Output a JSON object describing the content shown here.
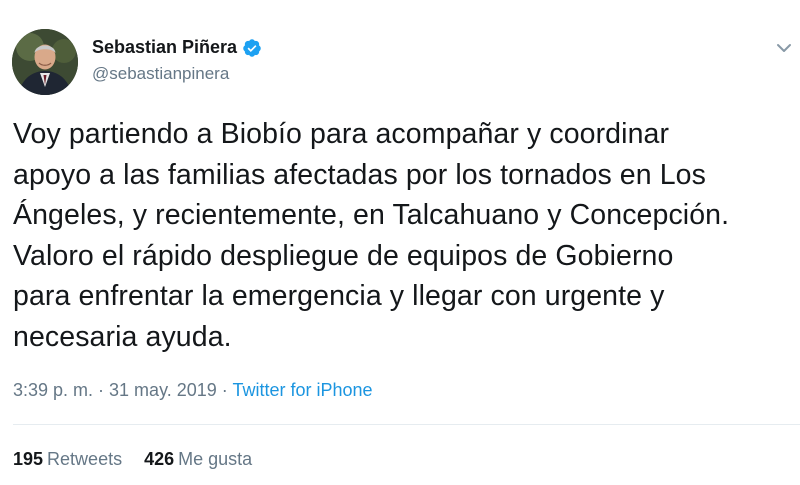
{
  "user": {
    "display_name": "Sebastian Piñera",
    "handle": "@sebastianpinera",
    "verified": true,
    "avatar_icon": "user-avatar-photo"
  },
  "tweet": {
    "text": "Voy partiendo a Biobío para acompañar y coordinar\napoyo a las familias afectadas por los tornados en Los\nÁngeles, y recientemente, en Talcahuano y Concepción.\nValoro el rápido despliegue de equipos de Gobierno\npara enfrentar la emergencia y llegar con urgente y\nnecesaria ayuda.",
    "timestamp": "3:39 p. m. · 31 may. 2019 ·",
    "source": "Twitter for iPhone"
  },
  "stats": {
    "retweets_count": "195",
    "retweets_label": "Retweets",
    "likes_count": "426",
    "likes_label": "Me gusta"
  },
  "colors": {
    "text": "#14171a",
    "secondary": "#657786",
    "link": "#1b95e0",
    "verified": "#1da1f2",
    "divider": "#e6ecf0"
  }
}
